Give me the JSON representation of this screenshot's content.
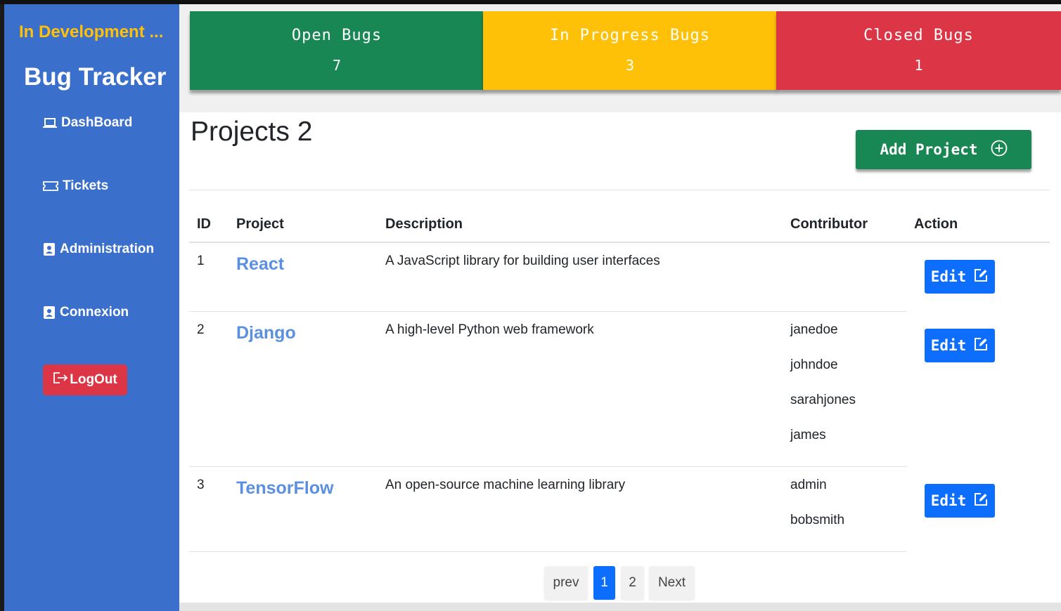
{
  "sidebar": {
    "status": "In Development ...",
    "title": "Bug Tracker",
    "nav": {
      "dashboard": "DashBoard",
      "tickets": "Tickets",
      "administration": "Administration",
      "connexion": "Connexion"
    },
    "logout": "LogOut"
  },
  "cards": {
    "open": {
      "label": "Open Bugs",
      "count": "7",
      "color": "#198754"
    },
    "in_progress": {
      "label": "In Progress Bugs",
      "count": "3",
      "color": "#ffc107"
    },
    "closed": {
      "label": "Closed Bugs",
      "count": "1",
      "color": "#dc3545"
    }
  },
  "projects": {
    "title": "Projects 2",
    "add_label": "Add Project",
    "headers": {
      "id": "ID",
      "project": "Project",
      "description": "Description",
      "contributor": "Contributor",
      "action": "Action"
    },
    "rows": [
      {
        "id": "1",
        "name": "React",
        "description": "A JavaScript library for building user interfaces",
        "contributors": [],
        "action": "Edit"
      },
      {
        "id": "2",
        "name": "Django",
        "description": "A high-level Python web framework",
        "contributors": [
          "janedoe",
          "johndoe",
          "sarahjones",
          "james"
        ],
        "action": "Edit"
      },
      {
        "id": "3",
        "name": "TensorFlow",
        "description": "An open-source machine learning library",
        "contributors": [
          "admin",
          "bobsmith"
        ],
        "action": "Edit"
      }
    ]
  },
  "pagination": {
    "prev": "prev",
    "pages": [
      "1",
      "2"
    ],
    "current": "1",
    "next": "Next"
  }
}
